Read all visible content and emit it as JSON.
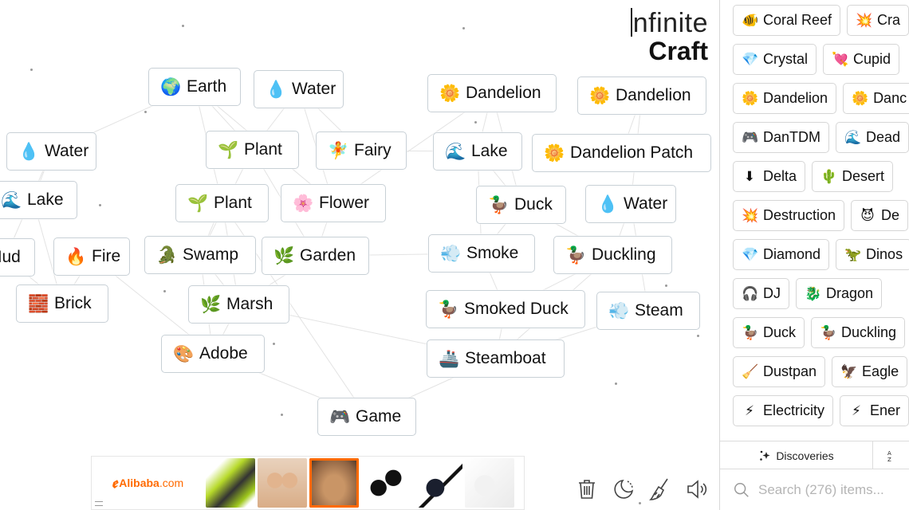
{
  "logo": {
    "line1": "nfinite",
    "line2": "Craft"
  },
  "canvas_nodes": [
    {
      "id": "earth",
      "label": "Earth",
      "emoji": "🌍"
    },
    {
      "id": "water1",
      "label": "Water",
      "emoji": "💧"
    },
    {
      "id": "dandelion1",
      "label": "Dandelion",
      "emoji": "🌼"
    },
    {
      "id": "dandelion2",
      "label": "Dandelion",
      "emoji": "🌼"
    },
    {
      "id": "water2",
      "label": "Water",
      "emoji": "💧"
    },
    {
      "id": "plant1",
      "label": "Plant",
      "emoji": "🌱"
    },
    {
      "id": "fairy",
      "label": "Fairy",
      "emoji": "🧚"
    },
    {
      "id": "lake1",
      "label": "Lake",
      "emoji": "🌊"
    },
    {
      "id": "dandelion-patch",
      "label": "Dandelion Patch",
      "emoji": "🌼"
    },
    {
      "id": "lake2",
      "label": "Lake",
      "emoji": "🌊"
    },
    {
      "id": "plant2",
      "label": "Plant",
      "emoji": "🌱"
    },
    {
      "id": "flower",
      "label": "Flower",
      "emoji": "🌸"
    },
    {
      "id": "duck",
      "label": "Duck",
      "emoji": "🦆"
    },
    {
      "id": "water3",
      "label": "Water",
      "emoji": "💧"
    },
    {
      "id": "mud",
      "label": "Mud",
      "emoji": ""
    },
    {
      "id": "fire",
      "label": "Fire",
      "emoji": "🔥"
    },
    {
      "id": "swamp",
      "label": "Swamp",
      "emoji": "🐊"
    },
    {
      "id": "garden",
      "label": "Garden",
      "emoji": "🌿"
    },
    {
      "id": "smoke",
      "label": "Smoke",
      "emoji": "💨"
    },
    {
      "id": "duckling",
      "label": "Duckling",
      "emoji": "🦆"
    },
    {
      "id": "brick",
      "label": "Brick",
      "emoji": "🧱"
    },
    {
      "id": "marsh",
      "label": "Marsh",
      "emoji": "🌿"
    },
    {
      "id": "smoked-duck",
      "label": "Smoked Duck",
      "emoji": "🦆"
    },
    {
      "id": "steam",
      "label": "Steam",
      "emoji": "💨"
    },
    {
      "id": "adobe",
      "label": "Adobe",
      "emoji": "🎨"
    },
    {
      "id": "steamboat",
      "label": "Steamboat",
      "emoji": "🚢"
    },
    {
      "id": "game",
      "label": "Game",
      "emoji": "🎮"
    }
  ],
  "sidebar": {
    "rows": [
      [
        {
          "label": "Coral Reef",
          "emoji": "🐠"
        },
        {
          "label": "Cra",
          "emoji": "💥"
        }
      ],
      [
        {
          "label": "Crystal",
          "emoji": "💎"
        },
        {
          "label": "Cupid",
          "emoji": "💘"
        }
      ],
      [
        {
          "label": "Dandelion",
          "emoji": "🌼"
        },
        {
          "label": "Danc",
          "emoji": "🌼"
        }
      ],
      [
        {
          "label": "DanTDM",
          "emoji": "🎮"
        },
        {
          "label": "Dead",
          "emoji": "🌊"
        }
      ],
      [
        {
          "label": "Delta",
          "emoji": "⬇"
        },
        {
          "label": "Desert",
          "emoji": "🌵"
        }
      ],
      [
        {
          "label": "Destruction",
          "emoji": "💥"
        },
        {
          "label": "De",
          "emoji": "😈"
        }
      ],
      [
        {
          "label": "Diamond",
          "emoji": "💎"
        },
        {
          "label": "Dinos",
          "emoji": "🦖"
        }
      ],
      [
        {
          "label": "DJ",
          "emoji": "🎧"
        },
        {
          "label": "Dragon",
          "emoji": "🐉"
        }
      ],
      [
        {
          "label": "Duck",
          "emoji": "🦆"
        },
        {
          "label": "Duckling",
          "emoji": "🦆"
        }
      ],
      [
        {
          "label": "Dustpan",
          "emoji": "🧹"
        },
        {
          "label": "Eagle",
          "emoji": "🦅"
        }
      ],
      [
        {
          "label": "Electricity",
          "emoji": "⚡"
        },
        {
          "label": "Ener",
          "emoji": "⚡"
        }
      ]
    ],
    "tabs": [
      {
        "label": "Discoveries",
        "icon": "sparkles-icon"
      },
      {
        "label": "",
        "icon": "sort-az-icon"
      }
    ],
    "search": {
      "placeholder": "Search (276) items...",
      "value": ""
    }
  },
  "toolbar": {
    "buttons": [
      {
        "name": "clear-canvas",
        "icon": "trash-icon"
      },
      {
        "name": "dark-mode",
        "icon": "moon-icon"
      },
      {
        "name": "clean-up",
        "icon": "broom-icon"
      },
      {
        "name": "sound",
        "icon": "speaker-icon"
      }
    ]
  },
  "ad": {
    "brand_name": "Alibaba",
    "brand_suffix": ".com",
    "brand_color": "#ff6a00",
    "products": [
      {
        "name": "green-card-terminal",
        "selected": false
      },
      {
        "name": "mannequin-torso",
        "selected": false
      },
      {
        "name": "mannequin-lower",
        "selected": true
      },
      {
        "name": "hdmi-adapter",
        "selected": false
      },
      {
        "name": "hdmi-vga-adapter",
        "selected": false
      },
      {
        "name": "white-adapter",
        "selected": false
      }
    ]
  }
}
